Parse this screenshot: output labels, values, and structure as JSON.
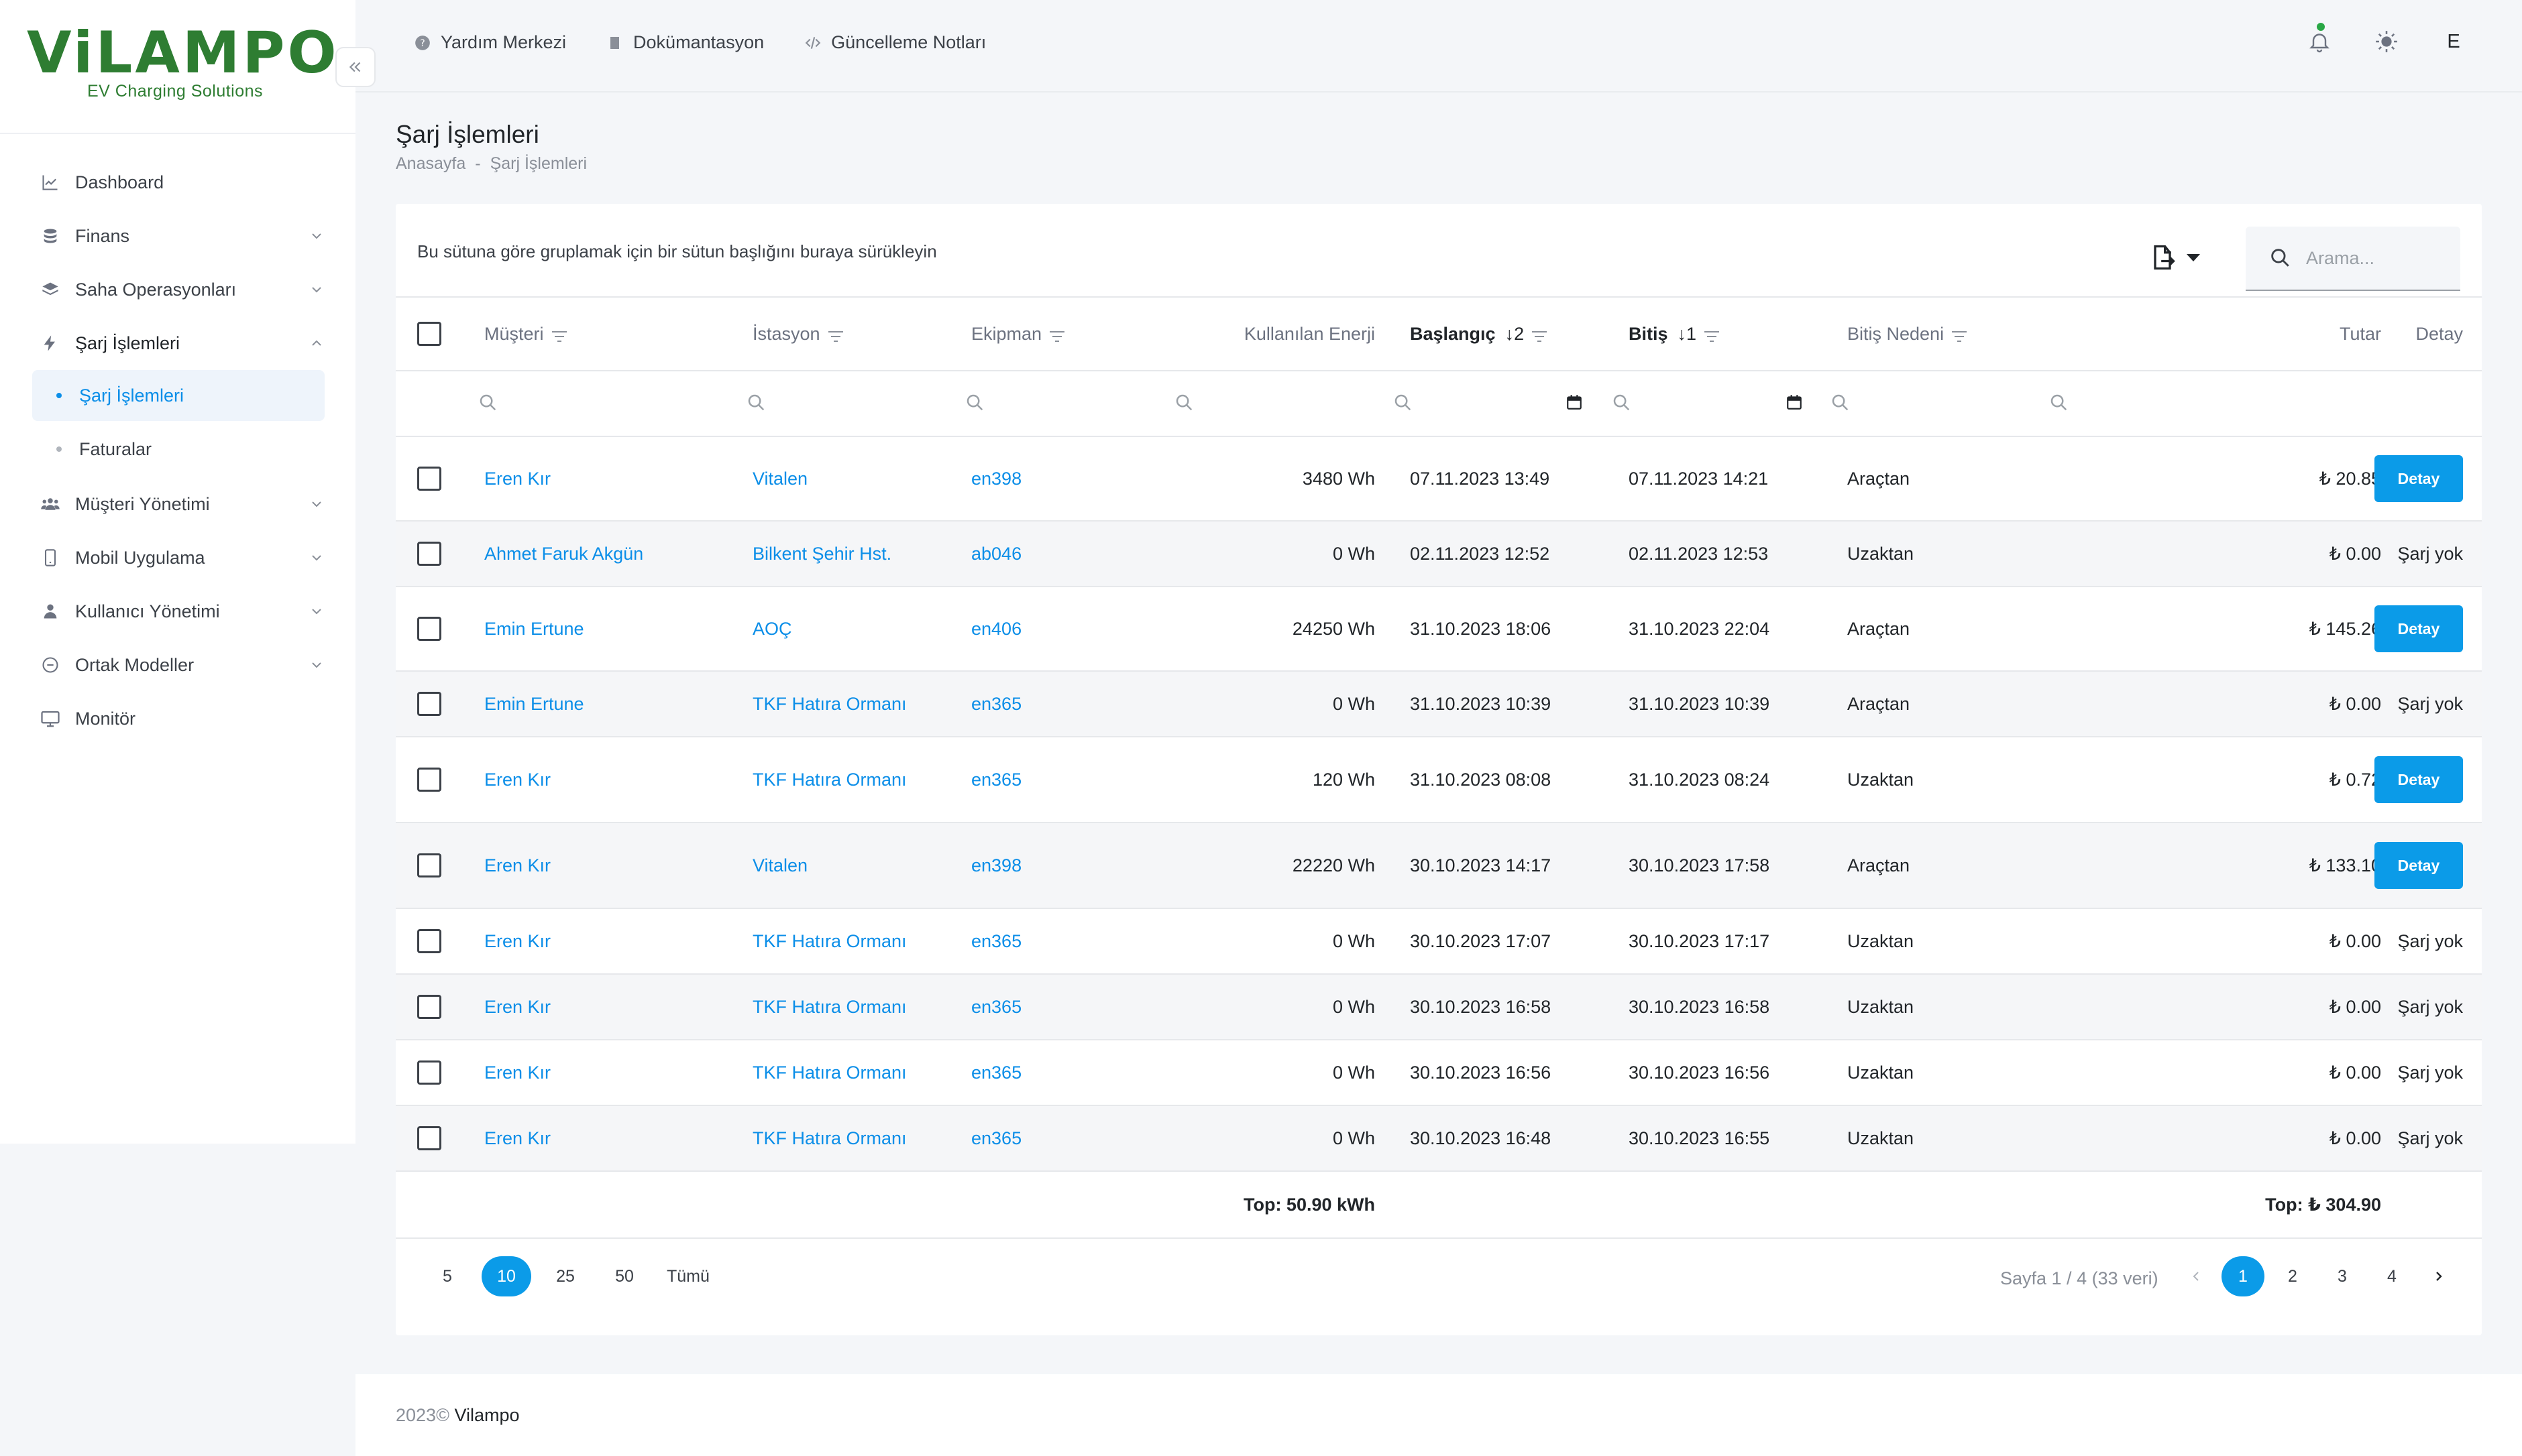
{
  "brand": {
    "name": "ViLAMPO",
    "tagline": "EV Charging Solutions",
    "color": "#2e7d32"
  },
  "sidebar": {
    "items": [
      {
        "label": "Dashboard",
        "icon": "chart-line-icon"
      },
      {
        "label": "Finans",
        "icon": "coins-icon"
      },
      {
        "label": "Saha Operasyonları",
        "icon": "layers-icon"
      },
      {
        "label": "Şarj İşlemleri",
        "icon": "bolt-icon",
        "open": true
      },
      {
        "label": "Müşteri Yönetimi",
        "icon": "users-icon"
      },
      {
        "label": "Mobil Uygulama",
        "icon": "mobile-icon"
      },
      {
        "label": "Kullanıcı Yönetimi",
        "icon": "user-icon"
      },
      {
        "label": "Ortak Modeller",
        "icon": "circle-icon"
      },
      {
        "label": "Monitör",
        "icon": "monitor-icon"
      }
    ],
    "sub_items": [
      {
        "label": "Şarj İşlemleri",
        "active": true
      },
      {
        "label": "Faturalar",
        "active": false
      }
    ]
  },
  "topbar": {
    "links": [
      {
        "label": "Yardım Merkezi",
        "icon": "help-circle-icon"
      },
      {
        "label": "Dokümantasyon",
        "icon": "book-icon"
      },
      {
        "label": "Güncelleme Notları",
        "icon": "code-icon"
      }
    ],
    "user_initial": "E"
  },
  "page": {
    "title": "Şarj İşlemleri",
    "breadcrumb": [
      "Anasayfa",
      "-",
      "Şarj İşlemleri"
    ]
  },
  "grid": {
    "group_hint": "Bu sütuna göre gruplamak için bir sütun başlığını buraya sürükleyin",
    "search_placeholder": "Arama...",
    "columns": {
      "customer": "Müşteri",
      "station": "İstasyon",
      "equipment": "Ekipman",
      "energy": "Kullanılan Enerji",
      "start": "Başlangıç",
      "start_sort": "↓2",
      "end": "Bitiş",
      "end_sort": "↓1",
      "reason": "Bitiş Nedeni",
      "amount": "Tutar",
      "detail": "Detay"
    },
    "detail_button_label": "Detay",
    "no_charge_label": "Şarj yok",
    "rows": [
      {
        "customer": "Eren Kır",
        "station": "Vitalen",
        "equipment": "en398",
        "energy": "3480 Wh",
        "start": "07.11.2023 13:49",
        "end": "07.11.2023 14:21",
        "reason": "Araçtan",
        "amount": "₺ 20.85",
        "has_detail": true
      },
      {
        "customer": "Ahmet Faruk Akgün",
        "station": "Bilkent Şehir Hst.",
        "equipment": "ab046",
        "energy": "0 Wh",
        "start": "02.11.2023 12:52",
        "end": "02.11.2023 12:53",
        "reason": "Uzaktan",
        "amount": "₺ 0.00",
        "has_detail": false
      },
      {
        "customer": "Emin Ertune",
        "station": "AOÇ",
        "equipment": "en406",
        "energy": "24250 Wh",
        "start": "31.10.2023 18:06",
        "end": "31.10.2023 22:04",
        "reason": "Araçtan",
        "amount": "₺ 145.26",
        "has_detail": true
      },
      {
        "customer": "Emin Ertune",
        "station": "TKF Hatıra Ormanı",
        "equipment": "en365",
        "energy": "0 Wh",
        "start": "31.10.2023 10:39",
        "end": "31.10.2023 10:39",
        "reason": "Araçtan",
        "amount": "₺ 0.00",
        "has_detail": false
      },
      {
        "customer": "Eren Kır",
        "station": "TKF Hatıra Ormanı",
        "equipment": "en365",
        "energy": "120 Wh",
        "start": "31.10.2023 08:08",
        "end": "31.10.2023 08:24",
        "reason": "Uzaktan",
        "amount": "₺ 0.72",
        "has_detail": true
      },
      {
        "customer": "Eren Kır",
        "station": "Vitalen",
        "equipment": "en398",
        "energy": "22220 Wh",
        "start": "30.10.2023 14:17",
        "end": "30.10.2023 17:58",
        "reason": "Araçtan",
        "amount": "₺ 133.10",
        "has_detail": true
      },
      {
        "customer": "Eren Kır",
        "station": "TKF Hatıra Ormanı",
        "equipment": "en365",
        "energy": "0 Wh",
        "start": "30.10.2023 17:07",
        "end": "30.10.2023 17:17",
        "reason": "Uzaktan",
        "amount": "₺ 0.00",
        "has_detail": false
      },
      {
        "customer": "Eren Kır",
        "station": "TKF Hatıra Ormanı",
        "equipment": "en365",
        "energy": "0 Wh",
        "start": "30.10.2023 16:58",
        "end": "30.10.2023 16:58",
        "reason": "Uzaktan",
        "amount": "₺ 0.00",
        "has_detail": false
      },
      {
        "customer": "Eren Kır",
        "station": "TKF Hatıra Ormanı",
        "equipment": "en365",
        "energy": "0 Wh",
        "start": "30.10.2023 16:56",
        "end": "30.10.2023 16:56",
        "reason": "Uzaktan",
        "amount": "₺ 0.00",
        "has_detail": false
      },
      {
        "customer": "Eren Kır",
        "station": "TKF Hatıra Ormanı",
        "equipment": "en365",
        "energy": "0 Wh",
        "start": "30.10.2023 16:48",
        "end": "30.10.2023 16:55",
        "reason": "Uzaktan",
        "amount": "₺ 0.00",
        "has_detail": false
      }
    ],
    "totals": {
      "energy": "Top: 50.90 kWh",
      "amount": "Top: ₺ 304.90"
    }
  },
  "pager": {
    "page_sizes": [
      "5",
      "10",
      "25",
      "50",
      "Tümü"
    ],
    "active_page_size": "10",
    "info": "Sayfa 1 / 4 (33 veri)",
    "pages": [
      "1",
      "2",
      "3",
      "4"
    ],
    "active_page": "1"
  },
  "footer": {
    "year": "2023©",
    "company": "Vilampo"
  },
  "colors": {
    "accent": "#0b9be8",
    "link": "#0b8ee8",
    "notification_dot": "#28a745"
  }
}
